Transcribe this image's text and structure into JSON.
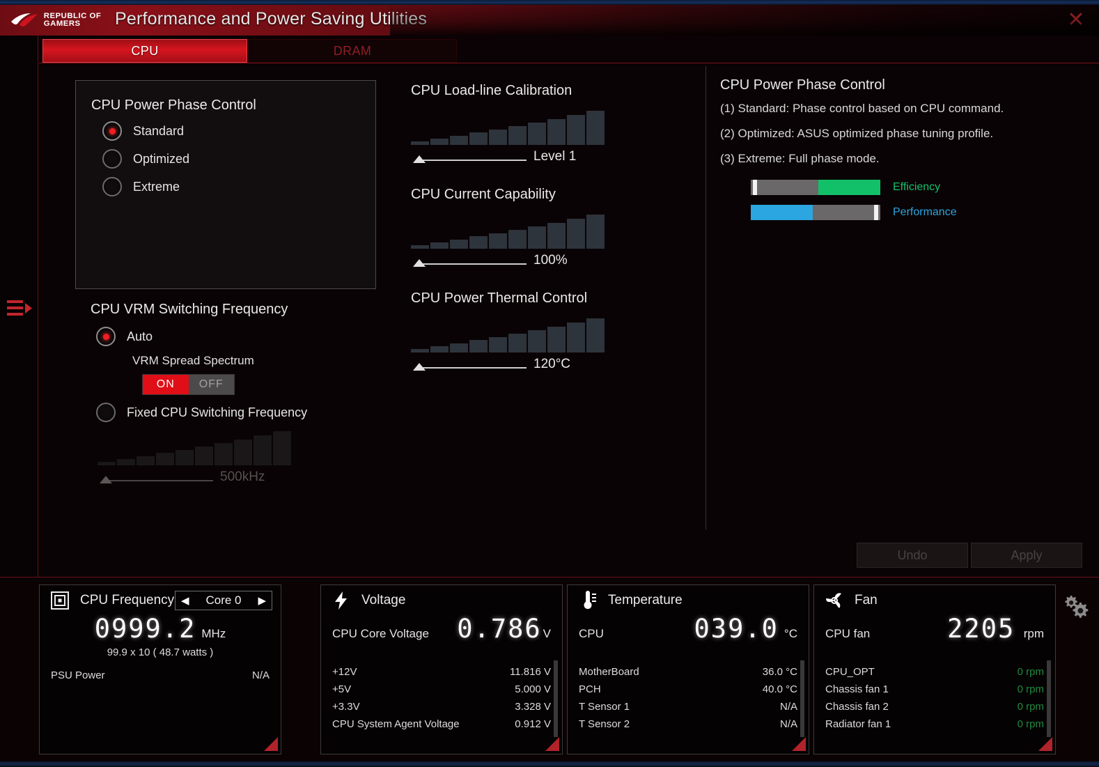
{
  "header": {
    "brand_line1": "REPUBLIC OF",
    "brand_line2": "GAMERS",
    "title": "Performance and Power Saving Utilities",
    "close_icon": "close-icon"
  },
  "tabs": [
    {
      "label": "CPU",
      "active": true
    },
    {
      "label": "DRAM",
      "active": false
    }
  ],
  "left_rail": {
    "menu_icon": "hamburger-menu-icon"
  },
  "settings": {
    "power_phase": {
      "title": "CPU Power Phase Control",
      "options": [
        {
          "label": "Standard",
          "selected": true
        },
        {
          "label": "Optimized",
          "selected": false
        },
        {
          "label": "Extreme",
          "selected": false
        }
      ]
    },
    "vrm": {
      "title": "CPU VRM Switching Frequency",
      "auto": {
        "label": "Auto",
        "selected": true
      },
      "spread_spectrum": {
        "label": "VRM Spread Spectrum",
        "on_label": "ON",
        "off_label": "OFF",
        "value": "ON"
      },
      "fixed": {
        "label": "Fixed CPU Switching Frequency",
        "selected": false
      },
      "fixed_slider": {
        "value": "500kHz",
        "enabled": false,
        "level": 1,
        "steps": 10
      }
    },
    "sliders": [
      {
        "title": "CPU Load-line Calibration",
        "value": "Level 1",
        "level": 1,
        "steps": 10
      },
      {
        "title": "CPU Current Capability",
        "value": "100%",
        "level": 1,
        "steps": 10
      },
      {
        "title": "CPU Power Thermal Control",
        "value": "120°C",
        "level": 1,
        "steps": 10
      }
    ]
  },
  "help": {
    "title": "CPU Power Phase Control",
    "lines": [
      "(1) Standard: Phase control based on CPU command.",
      "(2) Optimized: ASUS optimized phase tuning profile.",
      "(3) Extreme: Full phase mode."
    ],
    "meters": [
      {
        "label": "Efficiency",
        "color": "#13c06a",
        "fill_percent": 48,
        "fill_side": "right",
        "marker_side": "left"
      },
      {
        "label": "Performance",
        "color": "#2ba6e0",
        "fill_percent": 48,
        "fill_side": "left",
        "marker_side": "right"
      }
    ]
  },
  "actions": {
    "undo_label": "Undo",
    "apply_label": "Apply",
    "enabled": false
  },
  "monitor": {
    "cpu_frequency": {
      "icon": "cpu-chip-icon",
      "title": "CPU Frequency",
      "core_selector": {
        "value": "Core 0",
        "prev_icon": "arrow-left-icon",
        "next_icon": "arrow-right-icon"
      },
      "big_value": "0999.2",
      "big_unit": "MHz",
      "sub_text": "99.9  x  10      ( 48.7 watts )",
      "rows": [
        {
          "key": "PSU Power",
          "value": "N/A"
        }
      ]
    },
    "voltage": {
      "icon": "lightning-bolt-icon",
      "title": "Voltage",
      "primary_label": "CPU Core Voltage",
      "big_value": "0.786",
      "big_unit": "V",
      "rows": [
        {
          "key": "+12V",
          "value": "11.816  V"
        },
        {
          "key": "+5V",
          "value": "5.000  V"
        },
        {
          "key": "+3.3V",
          "value": "3.328  V"
        },
        {
          "key": "CPU System Agent Voltage",
          "value": "0.912  V"
        }
      ]
    },
    "temperature": {
      "icon": "thermometer-icon",
      "title": "Temperature",
      "primary_label": "CPU",
      "big_value": "039.0",
      "big_unit": "°C",
      "rows": [
        {
          "key": "MotherBoard",
          "value": "36.0 °C"
        },
        {
          "key": "PCH",
          "value": "40.0 °C"
        },
        {
          "key": "T Sensor 1",
          "value": "N/A"
        },
        {
          "key": "T Sensor 2",
          "value": "N/A"
        }
      ]
    },
    "fan": {
      "icon": "fan-icon",
      "title": "Fan",
      "primary_label": "CPU fan",
      "big_value": "2205",
      "big_unit": "rpm",
      "rows": [
        {
          "key": "CPU_OPT",
          "value": "0  rpm"
        },
        {
          "key": "Chassis fan 1",
          "value": "0  rpm"
        },
        {
          "key": "Chassis fan 2",
          "value": "0  rpm"
        },
        {
          "key": "Radiator fan 1",
          "value": "0  rpm"
        }
      ]
    },
    "settings_gear": {
      "icon": "gears-icon"
    }
  }
}
